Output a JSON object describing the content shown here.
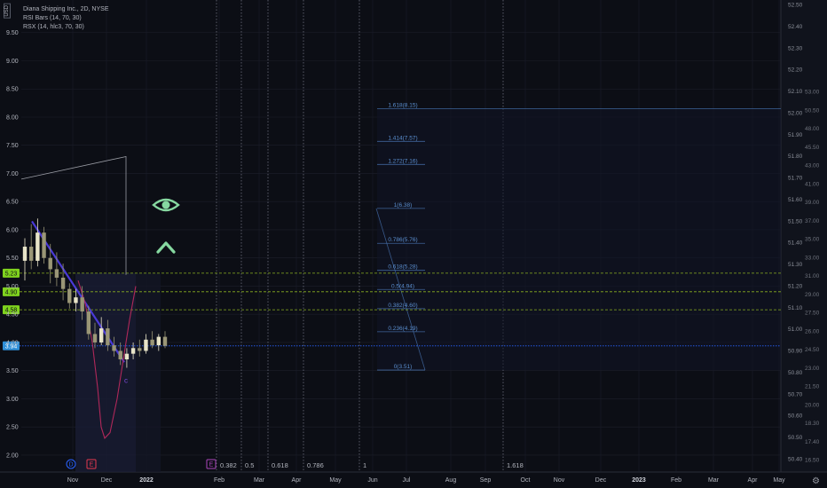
{
  "header": {
    "currency": "USD",
    "title": "Diana Shipping Inc., 2D, NYSE",
    "indicators": [
      "RSI Bars (14, 70, 30)",
      "RSX (14, hlc3, 70, 30)"
    ]
  },
  "colors": {
    "background": "#0c0e15",
    "grid": "#1c1f2a",
    "text": "#b2b5be",
    "up_candle": "#e8e4c8",
    "down_candle": "#9a9676",
    "trendline": "#4a3ad8",
    "rsx_line": "#b0285a",
    "fib_line": "#4a78b8",
    "fib_label": "#5b8fd0",
    "price_line": "#2962ff",
    "level_dashed": "#8ab020",
    "level_badge": "#7fd21e",
    "current_badge": "#2f8fd8",
    "eye_icon": "#86d8a0",
    "vertical_dotted": "#6b6f7c",
    "highlight": "#1a1d35"
  },
  "icons": {
    "eye": "eye-icon",
    "caret": "caret-up-icon",
    "marker_d": "dividend-marker-icon",
    "marker_e": "earnings-marker-icon",
    "settings": "gear-icon"
  },
  "chart_data": {
    "type": "candlestick",
    "x_axis": {
      "tick_labels": [
        "Nov",
        "Dec",
        "2022",
        "Feb",
        "Mar",
        "Apr",
        "May",
        "Jun",
        "Jul",
        "Aug",
        "Sep",
        "Oct",
        "Nov",
        "Dec",
        "2023",
        "Feb",
        "Mar",
        "Apr",
        "May"
      ],
      "bold_labels": [
        "2022",
        "2023"
      ]
    },
    "y_axis_left": {
      "min": 1.7,
      "max": 10.0,
      "ticks": [
        "2.00",
        "2.50",
        "3.00",
        "3.50",
        "4.00",
        "4.50",
        "5.00",
        "5.50",
        "6.00",
        "6.50",
        "7.00",
        "7.50",
        "8.00",
        "8.50",
        "9.00",
        "9.50"
      ]
    },
    "y_axis_right_outer": {
      "ticks": [
        "52.50",
        "52.40",
        "52.30",
        "52.20",
        "52.10",
        "52.00",
        "51.90",
        "51.80",
        "51.70",
        "51.60",
        "51.50",
        "51.40",
        "51.30",
        "51.20",
        "51.10",
        "51.00",
        "50.90",
        "50.80",
        "50.70",
        "50.60",
        "50.50",
        "50.40"
      ]
    },
    "y_axis_right_inner": {
      "ticks": [
        "53.00",
        "50.50",
        "48.00",
        "45.50",
        "43.00",
        "41.00",
        "39.00",
        "37.00",
        "35.00",
        "33.00",
        "31.00",
        "29.00",
        "27.50",
        "26.00",
        "24.50",
        "23.00",
        "21.50",
        "20.00",
        "18.30",
        "17.40",
        "16.50"
      ]
    },
    "price_levels": [
      {
        "label": "5.23",
        "price": 5.23
      },
      {
        "label": "4.90",
        "price": 4.9
      },
      {
        "label": "4.58",
        "price": 4.58
      }
    ],
    "current_price": {
      "label": "3.94",
      "price": 3.94
    },
    "candles": [
      {
        "o": 5.45,
        "h": 5.85,
        "l": 5.1,
        "c": 5.7
      },
      {
        "o": 5.7,
        "h": 6.1,
        "l": 5.3,
        "c": 5.45
      },
      {
        "o": 5.45,
        "h": 6.2,
        "l": 5.35,
        "c": 5.95
      },
      {
        "o": 5.95,
        "h": 6.05,
        "l": 5.4,
        "c": 5.5
      },
      {
        "o": 5.5,
        "h": 5.75,
        "l": 5.05,
        "c": 5.3
      },
      {
        "o": 5.3,
        "h": 5.6,
        "l": 5.0,
        "c": 5.15
      },
      {
        "o": 5.15,
        "h": 5.4,
        "l": 4.75,
        "c": 4.95
      },
      {
        "o": 4.95,
        "h": 5.05,
        "l": 4.6,
        "c": 4.7
      },
      {
        "o": 4.7,
        "h": 4.95,
        "l": 4.55,
        "c": 4.8
      },
      {
        "o": 4.8,
        "h": 5.0,
        "l": 4.4,
        "c": 4.55
      },
      {
        "o": 4.55,
        "h": 4.65,
        "l": 4.05,
        "c": 4.15
      },
      {
        "o": 4.15,
        "h": 4.35,
        "l": 3.9,
        "c": 4.0
      },
      {
        "o": 4.0,
        "h": 4.45,
        "l": 3.95,
        "c": 4.25
      },
      {
        "o": 4.25,
        "h": 4.4,
        "l": 3.85,
        "c": 3.95
      },
      {
        "o": 3.95,
        "h": 4.1,
        "l": 3.75,
        "c": 3.85
      },
      {
        "o": 3.85,
        "h": 4.0,
        "l": 3.6,
        "c": 3.7
      },
      {
        "o": 3.7,
        "h": 3.9,
        "l": 3.55,
        "c": 3.8
      },
      {
        "o": 3.8,
        "h": 4.0,
        "l": 3.7,
        "c": 3.9
      },
      {
        "o": 3.9,
        "h": 4.05,
        "l": 3.75,
        "c": 3.85
      },
      {
        "o": 3.85,
        "h": 4.15,
        "l": 3.8,
        "c": 4.05
      },
      {
        "o": 4.05,
        "h": 4.2,
        "l": 3.9,
        "c": 3.95
      },
      {
        "o": 3.95,
        "h": 4.15,
        "l": 3.85,
        "c": 4.1
      },
      {
        "o": 4.1,
        "h": 4.2,
        "l": 3.9,
        "c": 3.94
      }
    ],
    "annotations": [
      {
        "type": "letter",
        "text": "c"
      }
    ],
    "fibonacci": {
      "levels": [
        {
          "label": "1.618(8.15)",
          "price": 8.15
        },
        {
          "label": "1.414(7.57)",
          "price": 7.57
        },
        {
          "label": "1.272(7.16)",
          "price": 7.16
        },
        {
          "label": "1(6.38)",
          "price": 6.38
        },
        {
          "label": "0.786(5.76)",
          "price": 5.76
        },
        {
          "label": "0.618(5.28)",
          "price": 5.28
        },
        {
          "label": "0.5(4.94)",
          "price": 4.94
        },
        {
          "label": "0.382(4.60)",
          "price": 4.6
        },
        {
          "label": "0.236(4.19)",
          "price": 4.19
        },
        {
          "label": "0(3.51)",
          "price": 3.51
        }
      ]
    },
    "time_fib_labels": [
      "0.382",
      "0.5",
      "0.618",
      "0.786",
      "1",
      "1.618"
    ],
    "rsx_line_approx": [
      5.1,
      4.7,
      4.0,
      3.2,
      2.5,
      2.3,
      2.4,
      3.0,
      3.8,
      4.4,
      5.0
    ],
    "bottom_markers": [
      "D",
      "E",
      "E"
    ]
  }
}
